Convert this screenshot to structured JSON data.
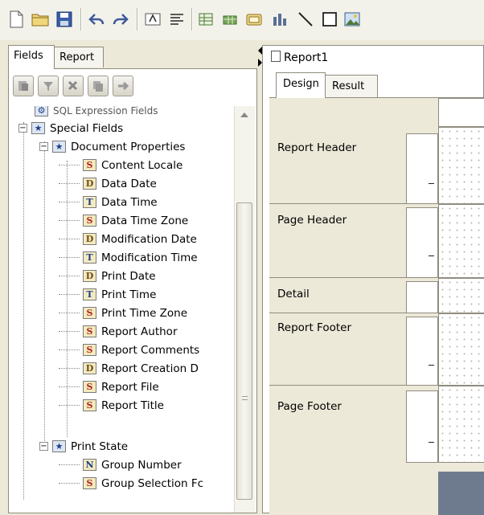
{
  "left_panel": {
    "tabs": [
      "Fields",
      "Report"
    ],
    "active_tab": "Fields"
  },
  "tree": {
    "partial_top": "SQL Expression Fields",
    "special_fields": "Special Fields",
    "document_properties": "Document Properties",
    "document_items": [
      {
        "badge": "S",
        "label": "Content Locale"
      },
      {
        "badge": "D",
        "label": "Data Date"
      },
      {
        "badge": "T",
        "label": "Data Time"
      },
      {
        "badge": "S",
        "label": "Data Time Zone"
      },
      {
        "badge": "D",
        "label": "Modification Date"
      },
      {
        "badge": "T",
        "label": "Modification Time"
      },
      {
        "badge": "D",
        "label": "Print Date"
      },
      {
        "badge": "T",
        "label": "Print Time"
      },
      {
        "badge": "S",
        "label": "Print Time Zone"
      },
      {
        "badge": "S",
        "label": "Report Author"
      },
      {
        "badge": "S",
        "label": "Report Comments"
      },
      {
        "badge": "D",
        "label": "Report Creation D"
      },
      {
        "badge": "S",
        "label": "Report File"
      },
      {
        "badge": "S",
        "label": "Report Title"
      }
    ],
    "print_state": "Print State",
    "print_items": [
      {
        "badge": "N",
        "label": "Group Number"
      },
      {
        "badge": "S",
        "label": "Group Selection Fc"
      }
    ]
  },
  "right_panel": {
    "title": "Report1",
    "tabs": [
      "Design",
      "Result"
    ],
    "active_tab": "Design",
    "sections": [
      "Report Header",
      "Page Header",
      "Detail",
      "Report Footer",
      "Page Footer"
    ]
  }
}
